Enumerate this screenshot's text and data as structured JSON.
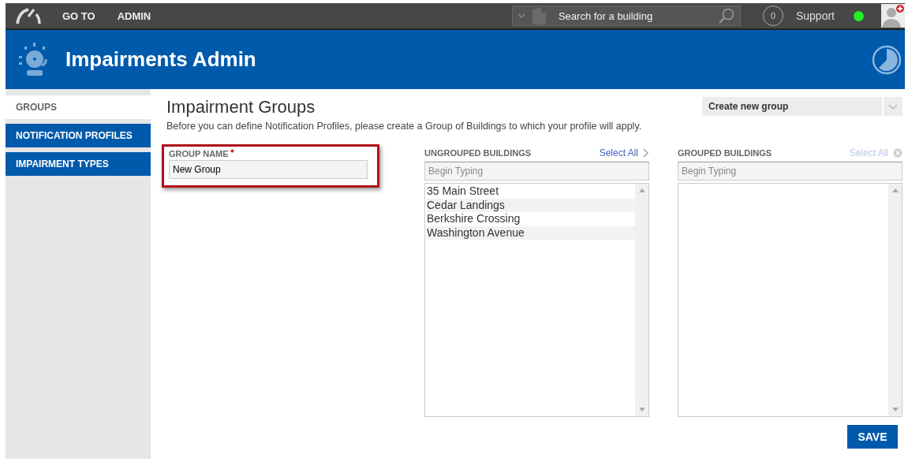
{
  "topbar": {
    "nav": [
      "GO TO",
      "ADMIN"
    ],
    "search": {
      "placeholder": "Search for a building"
    },
    "notifications": "0",
    "support": "Support",
    "online": true
  },
  "header": {
    "title": "Impairments Admin"
  },
  "sidebar": {
    "items": [
      {
        "label": "GROUPS",
        "selected": true
      },
      {
        "label": "NOTIFICATION PROFILES",
        "selected": false
      },
      {
        "label": "IMPAIRMENT TYPES",
        "selected": false
      }
    ]
  },
  "main": {
    "title": "Impairment Groups",
    "intro": "Before you can define Notification Profiles, please create a Group of Buildings to which your profile will apply.",
    "group_select": "Create new group",
    "group_name": {
      "label": "GROUP NAME",
      "required": true,
      "value": "New Group",
      "highlighted": true
    },
    "lists": [
      {
        "title": "UNGROUPED BUILDINGS",
        "select_all": "Select All",
        "disabled": false,
        "kind": "move",
        "placeholder": "Begin Typing",
        "items": [
          "35 Main Street",
          "Cedar Landings",
          "Berkshire Crossing",
          "Washington Avenue"
        ]
      },
      {
        "title": "GROUPED BUILDINGS",
        "select_all": "Select All",
        "disabled": true,
        "kind": "clear",
        "placeholder": "Begin Typing"
      }
    ],
    "save": "SAVE"
  }
}
